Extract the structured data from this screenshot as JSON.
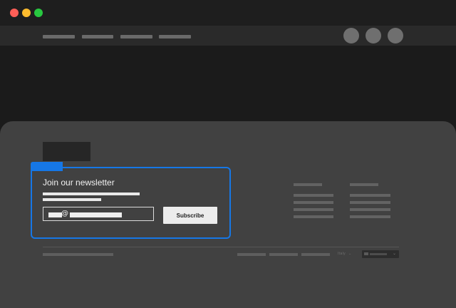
{
  "window": {
    "controls": [
      "close-icon",
      "minimize-icon",
      "maximize-icon"
    ]
  },
  "navbar": {
    "links": [
      "",
      "",
      "",
      ""
    ],
    "icons": [
      "account-icon",
      "cart-icon",
      "menu-icon"
    ]
  },
  "newsletter": {
    "title": "Join our newsletter",
    "email_at_symbol": "@",
    "subscribe_label": "Subscribe",
    "accent_color": "#1677e6"
  },
  "footer": {
    "language": {
      "label": "Italy",
      "chevron": "⌄"
    },
    "region_select": {
      "icon": "flag-icon",
      "chevron": "⌄"
    }
  }
}
